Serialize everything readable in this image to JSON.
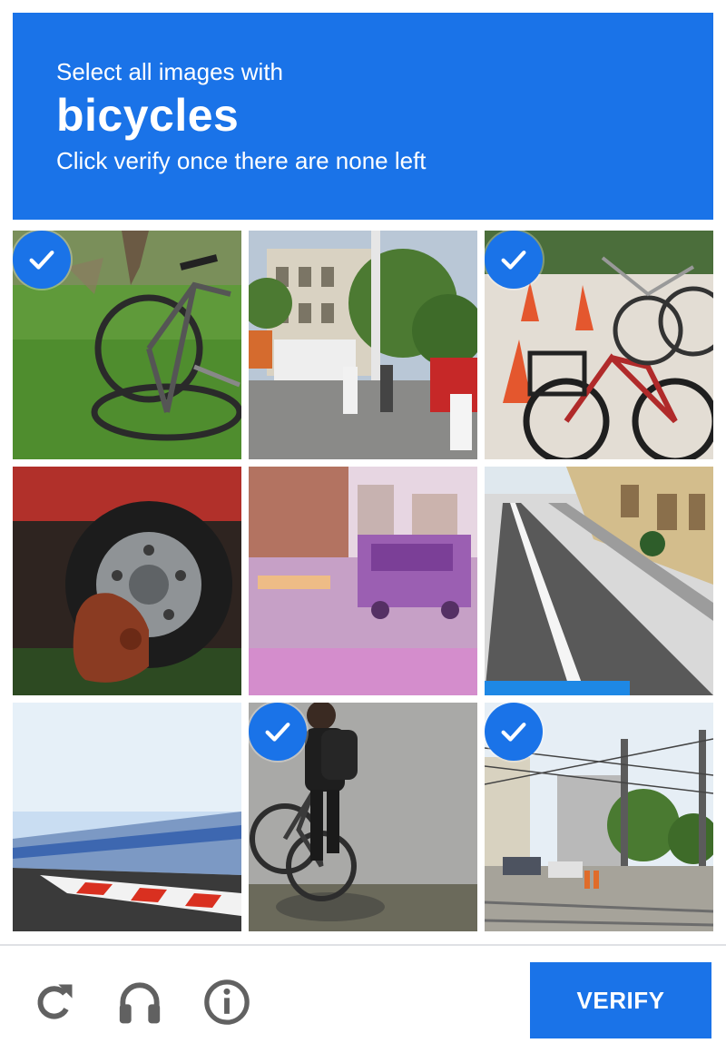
{
  "header": {
    "instruction": "Select all images with",
    "target": "bicycles",
    "hint": "Click verify once there are none left"
  },
  "grid": {
    "tiles": [
      {
        "subject": "bicycle lying on grass",
        "selected": true
      },
      {
        "subject": "street with buildings and people",
        "selected": false
      },
      {
        "subject": "parked bicycles with traffic cones",
        "selected": true
      },
      {
        "subject": "car tire and fire hydrant",
        "selected": false
      },
      {
        "subject": "street at dusk with truck",
        "selected": false
      },
      {
        "subject": "empty road with sidewalk",
        "selected": false
      },
      {
        "subject": "highway barrier",
        "selected": false
      },
      {
        "subject": "cyclist on street",
        "selected": true
      },
      {
        "subject": "street with tram wires",
        "selected": true
      }
    ]
  },
  "footer": {
    "reload_icon": "reload-icon",
    "audio_icon": "headphones-icon",
    "info_icon": "info-icon",
    "verify_label": "VERIFY"
  },
  "colors": {
    "accent": "#1a73e8",
    "divider": "#dfe1e5",
    "icon": "#616161"
  }
}
